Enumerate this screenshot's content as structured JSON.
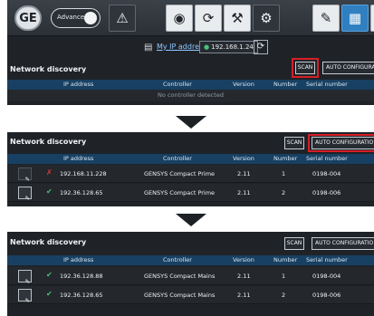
{
  "toolbar": {
    "logo": "GE",
    "advanced_label": "Advanced",
    "warning_icon": "warning-icon",
    "view_icon": "eye-icon",
    "settings_icon": "settings-cycle-icon",
    "tools_icon": "tools-icon",
    "gears_icon": "gears-icon",
    "edit_icon": "pen-icon",
    "network_icon": "network-icon"
  },
  "ip_bar": {
    "link": "My IP address",
    "ip": "192.168.1.24"
  },
  "colors": {
    "highlight": "#d61f26",
    "ok": "#49c07a",
    "error": "#e03b3b",
    "header": "#184062"
  },
  "panels": [
    {
      "title": "Network discovery",
      "scan": "SCAN",
      "auto": "AUTO CONFIGURATION",
      "headers": [
        "IP address",
        "Controller",
        "Version",
        "Number",
        "Serial number"
      ],
      "empty": "No controller detected"
    },
    {
      "title": "Network discovery",
      "scan": "SCAN",
      "auto": "AUTO CONFIGURATIO",
      "headers": [
        "IP address",
        "Controller",
        "Version",
        "Number",
        "Serial number"
      ],
      "rows": [
        {
          "status": "error",
          "ip": "192.168.11.228",
          "controller": "GENSYS Compact Prime",
          "version": "2.11",
          "number": "1",
          "serial": "0198-004"
        },
        {
          "status": "ok",
          "ip": "192.36.128.65",
          "controller": "GENSYS Compact Prime",
          "version": "2.11",
          "number": "2",
          "serial": "0198-006"
        }
      ]
    },
    {
      "title": "Network discovery",
      "scan": "SCAN",
      "auto": "AUTO CONFIGURATIO",
      "headers": [
        "IP address",
        "Controller",
        "Version",
        "Number",
        "Serial number"
      ],
      "rows": [
        {
          "status": "ok",
          "ip": "192.36.128.88",
          "controller": "GENSYS Compact Mains",
          "version": "2.11",
          "number": "1",
          "serial": "0198-004"
        },
        {
          "status": "ok",
          "ip": "192.36.128.65",
          "controller": "GENSYS Compact Mains",
          "version": "2.11",
          "number": "2",
          "serial": "0198-006"
        }
      ]
    }
  ]
}
